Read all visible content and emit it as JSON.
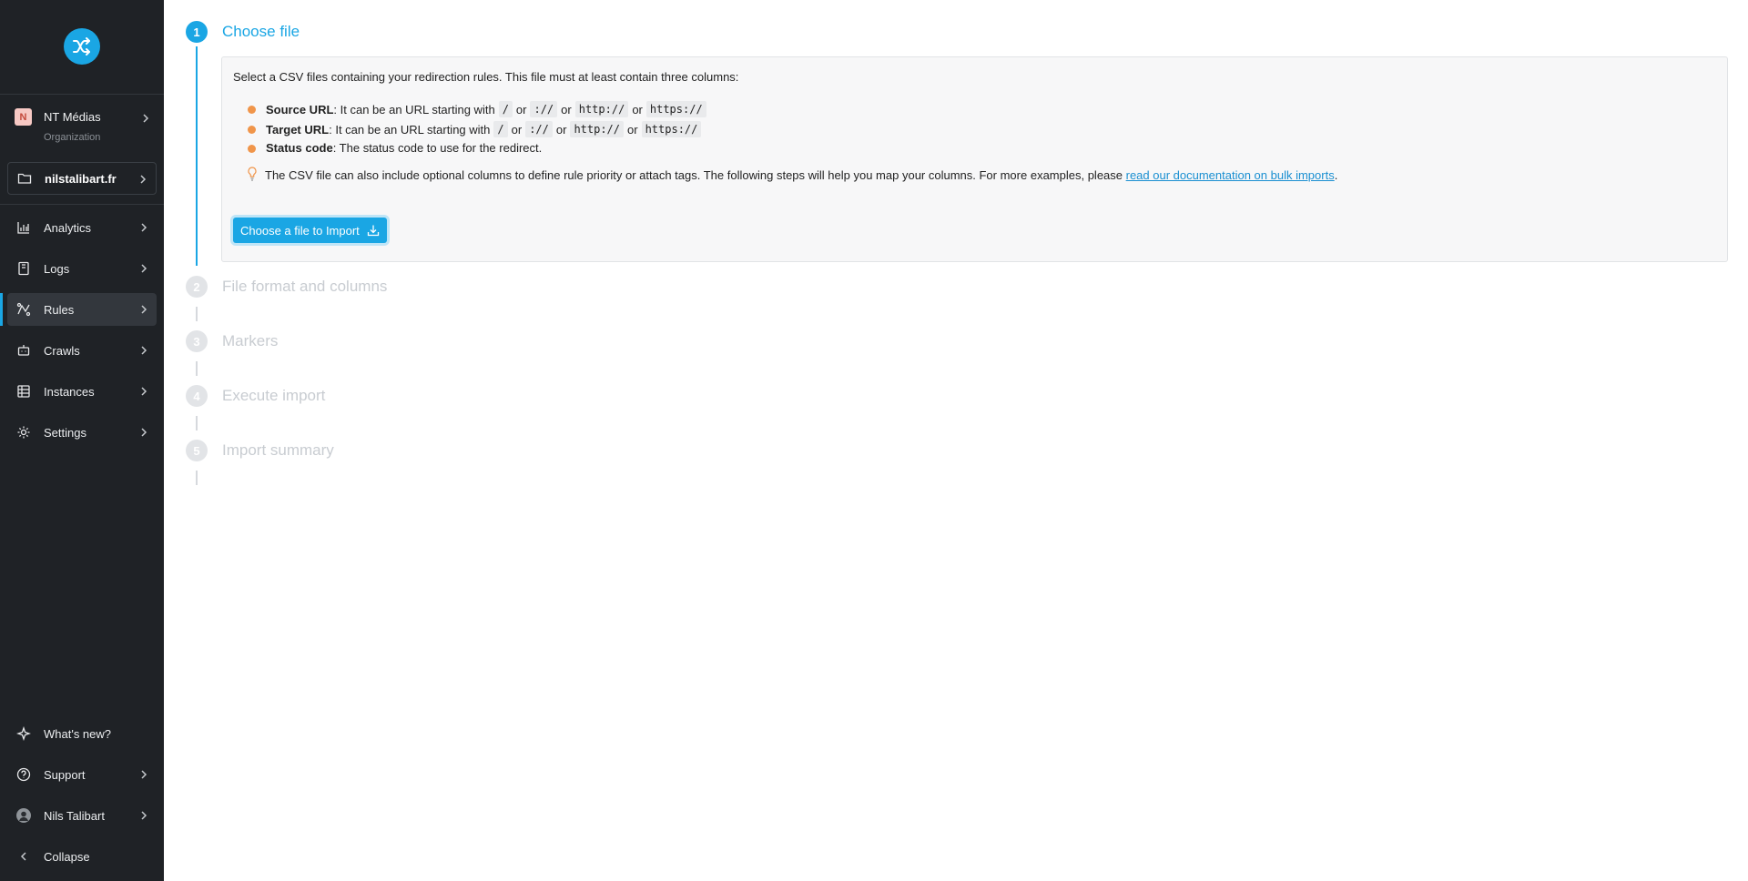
{
  "sidebar": {
    "organization": {
      "initial": "N",
      "name": "NT Médias",
      "type": "Organization"
    },
    "project": {
      "name": "nilstalibart.fr"
    },
    "nav": [
      {
        "label": "Analytics",
        "icon": "chart-icon"
      },
      {
        "label": "Logs",
        "icon": "log-icon"
      },
      {
        "label": "Rules",
        "icon": "rules-icon",
        "active": true
      },
      {
        "label": "Crawls",
        "icon": "crawl-icon"
      },
      {
        "label": "Instances",
        "icon": "instances-icon"
      },
      {
        "label": "Settings",
        "icon": "gear-icon"
      }
    ],
    "bottom": [
      {
        "label": "What's new?",
        "icon": "sparkle-icon"
      },
      {
        "label": "Support",
        "icon": "help-icon"
      },
      {
        "label": "Nils Talibart",
        "icon": "avatar"
      },
      {
        "label": "Collapse",
        "icon": "chevron-left-icon"
      }
    ]
  },
  "steps": [
    {
      "number": "1",
      "title": "Choose file",
      "active": true
    },
    {
      "number": "2",
      "title": "File format and columns"
    },
    {
      "number": "3",
      "title": "Markers"
    },
    {
      "number": "4",
      "title": "Execute import"
    },
    {
      "number": "5",
      "title": "Import summary"
    }
  ],
  "choose_file": {
    "intro": "Select a CSV files containing your redirection rules. This file must at least contain three columns:",
    "source": {
      "label": "Source URL",
      "text": ": It can be an URL starting with",
      "codes": [
        "/",
        "://",
        "http://",
        "https://"
      ],
      "or": "or"
    },
    "target": {
      "label": "Target URL",
      "text": ": It can be an URL starting with",
      "codes": [
        "/",
        "://",
        "http://",
        "https://"
      ],
      "or": "or"
    },
    "status": {
      "label": "Status code",
      "text": ": The status code to use for the redirect."
    },
    "tip_text": "The CSV file can also include optional columns to define rule priority or attach tags. The following steps will help you map your columns. For more examples, please ",
    "tip_link": "read our documentation on bulk imports",
    "tip_end": ".",
    "button_label": "Choose a file to Import"
  },
  "colors": {
    "accent": "#1aa6e4",
    "sidebar_bg": "#1f2226",
    "bullet": "#f0954a"
  }
}
